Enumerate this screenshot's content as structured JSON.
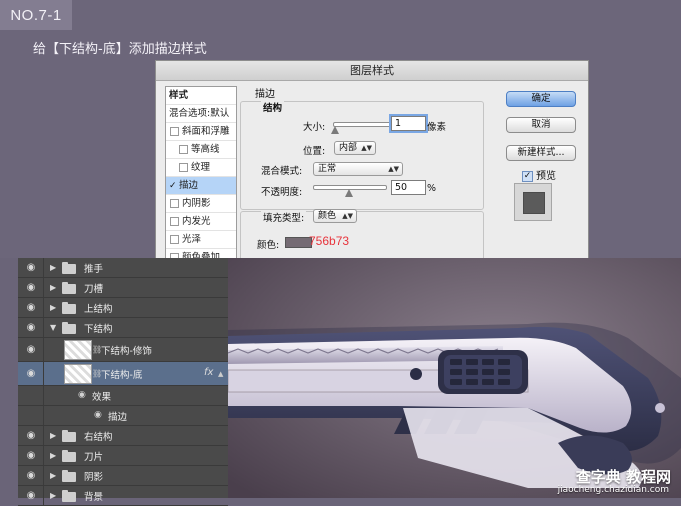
{
  "step_badge": "NO.7-1",
  "instruction": "给【下结构-底】添加描边样式",
  "dialog": {
    "title": "图层样式",
    "style_list": [
      {
        "label": "样式",
        "kind": "header"
      },
      {
        "label": "混合选项:默认",
        "kind": "blend"
      },
      {
        "label": "斜面和浮雕",
        "kind": "check",
        "checked": false
      },
      {
        "label": "等高线",
        "kind": "sub",
        "checked": false
      },
      {
        "label": "纹理",
        "kind": "sub",
        "checked": false
      },
      {
        "label": "描边",
        "kind": "check",
        "checked": true,
        "selected": true
      },
      {
        "label": "内阴影",
        "kind": "check",
        "checked": false
      },
      {
        "label": "内发光",
        "kind": "check",
        "checked": false
      },
      {
        "label": "光泽",
        "kind": "check",
        "checked": false
      },
      {
        "label": "颜色叠加",
        "kind": "check",
        "checked": false
      }
    ],
    "section_title": "描边",
    "structure": {
      "legend": "结构",
      "size_label": "大小:",
      "size_value": "1",
      "size_unit": "像素",
      "position_label": "位置:",
      "position_value": "内部",
      "blend_mode_label": "混合模式:",
      "blend_mode_value": "正常",
      "opacity_label": "不透明度:",
      "opacity_value": "50",
      "opacity_unit": "%",
      "size_slider_level": 0.02,
      "opacity_slider_level": 0.5
    },
    "fill": {
      "type_label": "填充类型:",
      "type_value": "颜色",
      "color_label": "颜色:",
      "color_hex_text": "756b73",
      "swatch_color": "#756b73",
      "hex_text_color": "#e8343c"
    },
    "buttons": {
      "ok": "确定",
      "cancel": "取消",
      "new_style": "新建样式...",
      "preview": "预览"
    },
    "preview_checked": true
  },
  "layers": [
    {
      "name": "推手",
      "type": "folder",
      "expanded": false
    },
    {
      "name": "刀槽",
      "type": "folder",
      "expanded": false
    },
    {
      "name": "上结构",
      "type": "folder",
      "expanded": false
    },
    {
      "name": "下结构",
      "type": "folder",
      "expanded": true
    },
    {
      "name": "下结构-修饰",
      "type": "layer",
      "indent": 1
    },
    {
      "name": "下结构-底",
      "type": "layer",
      "indent": 1,
      "selected": true,
      "fx": "fx"
    },
    {
      "name": "效果",
      "type": "effects",
      "indent": 2
    },
    {
      "name": "描边",
      "type": "effect",
      "indent": 3
    },
    {
      "name": "右结构",
      "type": "folder",
      "expanded": false
    },
    {
      "name": "刀片",
      "type": "folder",
      "expanded": false
    },
    {
      "name": "阴影",
      "type": "folder",
      "expanded": false
    },
    {
      "name": "背景",
      "type": "folder",
      "expanded": false
    }
  ],
  "icons": {
    "eye": "eye-icon",
    "folder": "folder-icon",
    "collapsed": "triangle-right-icon",
    "expanded": "triangle-down-icon",
    "chain": "link-icon",
    "fx": "fx-icon"
  },
  "colors": {
    "background": "#6a6478",
    "selected_layer": "#5b6f8c",
    "primary_button": "#6ea1e4"
  },
  "watermark": {
    "main": "查字典 教程网",
    "url": "jiaocheng.chazidian.com"
  }
}
